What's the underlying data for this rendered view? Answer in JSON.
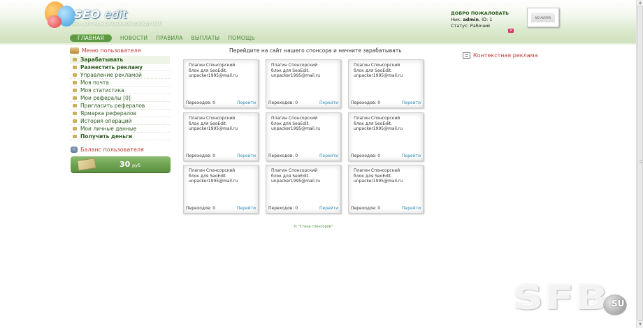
{
  "header": {
    "logo_title_a": "SEO",
    "logo_title_b": "edit",
    "logo_subtitle": "Все для максимальной раскрутки!",
    "nav": [
      "ГЛАВНАЯ",
      "НОВОСТИ",
      "ПРАВИЛА",
      "ВЫПЛАТЫ",
      "ПОМОЩЬ"
    ],
    "welcome_title": "ДОБРО ПОЖАЛОВАТЬ",
    "nick_label": "Ник:",
    "nick_value": "admin",
    "id_text": ", ID: 1",
    "status_text": "Статус: Рабочий",
    "avatar_text": "NO AVATAR",
    "logout_icon": "close-icon",
    "logout_color": "#d23a6b"
  },
  "sidebar": {
    "menu_title": "Меню пользователя",
    "items": [
      {
        "label": "Зарабатывать",
        "bold": true
      },
      {
        "label": "Разместить рекламу",
        "bold": true
      },
      {
        "label": "Управление рекламой",
        "bold": false
      },
      {
        "label": "Моя почта",
        "bold": false
      },
      {
        "label": "Моя статистика",
        "bold": false
      },
      {
        "label": "Мои рефералы [0]",
        "bold": false
      },
      {
        "label": "Пригласить рефералов",
        "bold": false
      },
      {
        "label": "Ярмарка рефералов",
        "bold": false
      },
      {
        "label": "История операций",
        "bold": false
      },
      {
        "label": "Мои личные данные",
        "bold": false
      },
      {
        "label": "Получить деньги",
        "bold": true
      }
    ],
    "balance_title": "Баланс пользователя",
    "balance_value": "30",
    "balance_unit": "руб"
  },
  "main": {
    "title": "Перейдите на сайт нашего спонсора и начните зарабатывать",
    "card_text_line1": "Плагин Спонсорский",
    "card_text_line2": "блок для SeoEdit.",
    "card_text_line3": "unpacker1995@mail.ru",
    "card_count_label": "Переходов: 0",
    "card_go_label": "Перейти",
    "footer_link": "© \"Стена спонсоров\""
  },
  "right": {
    "context_title": "Контекстная реклама"
  },
  "watermark": {
    "text": "SFB",
    "badge": "SU"
  },
  "colors": {
    "accent_green": "#5d9a43",
    "menu_text": "#2f5a23",
    "heading_red": "#c23a3a",
    "link_blue": "#2b8ab0"
  }
}
